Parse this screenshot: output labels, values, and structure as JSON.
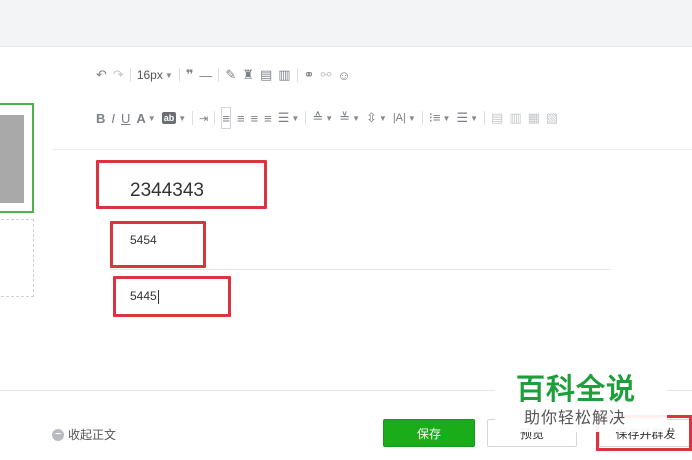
{
  "toolbar": {
    "font_size": "16px"
  },
  "editor": {
    "line1": "2344343",
    "line2": "5454",
    "line3": "5445"
  },
  "footer": {
    "collapse_label": "收起正文",
    "save_label": "保存",
    "preview_label": "预览",
    "publish_label": "保存并群发"
  },
  "watermark": {
    "title": "百科全说",
    "subtitle": "助你轻松解决"
  },
  "colors": {
    "accent_green": "#1aad19",
    "highlight_red": "#d9353f",
    "watermark_green": "#1f9e3c"
  }
}
